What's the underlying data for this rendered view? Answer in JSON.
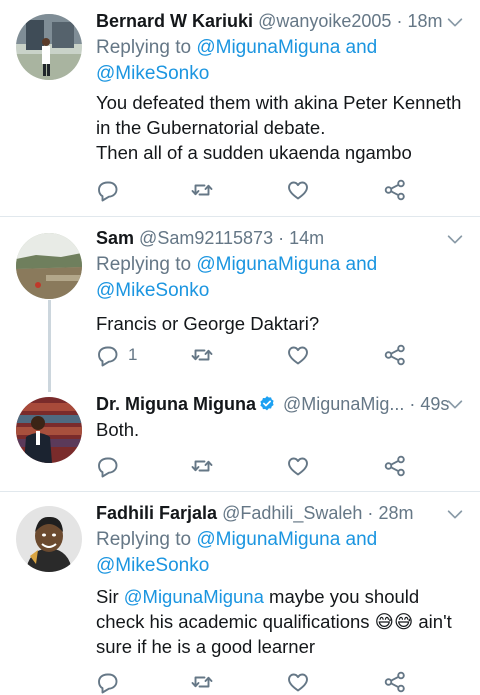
{
  "tweets": [
    {
      "name": "Bernard W Kariuki",
      "handle": "@wanyoike2005",
      "dot": "·",
      "time": "18m",
      "replying_prefix": "Replying to",
      "replying_to": [
        "@MigunaMiguna",
        "@MikeSonko"
      ],
      "replying_and": "and",
      "text_lines": [
        "You defeated them with akina Peter Kenneth",
        "in the Gubernatorial debate.",
        "Then all of a sudden ukaenda ngambo"
      ],
      "reply_count": ""
    },
    {
      "name": "Sam",
      "handle": "@Sam92115873",
      "dot": "·",
      "time": "14m",
      "replying_prefix": "Replying to",
      "replying_to": [
        "@MigunaMiguna",
        "@MikeSonko"
      ],
      "replying_and": "and",
      "text_lines": [
        "Francis or George Daktari?"
      ],
      "reply_count": "1"
    },
    {
      "name": "Dr. Miguna Miguna",
      "handle": "@MigunaMig...",
      "dot": "·",
      "time": "49s",
      "verified": true,
      "text_lines": [
        "Both."
      ],
      "reply_count": ""
    },
    {
      "name": "Fadhili Farjala",
      "handle": "@Fadhili_Swaleh",
      "dot": "·",
      "time": "28m",
      "replying_prefix": "Replying to",
      "replying_to": [
        "@MigunaMiguna",
        "@MikeSonko"
      ],
      "replying_and": "and",
      "text_parts": {
        "pre": "Sir ",
        "mention": "@MigunaMiguna",
        "mid": " maybe you should check his academic qualifications ",
        "emoji": "😅😅",
        "post": " ain't sure if he is a good learner"
      },
      "reply_count": ""
    }
  ],
  "icons": [
    "reply-icon",
    "retweet-icon",
    "like-icon",
    "share-icon",
    "chevron-down-icon",
    "verified-badge-icon"
  ],
  "colors": {
    "link": "#1b95e0",
    "secondary": "#657786",
    "divider": "#e1e8ed",
    "verified": "#1da1f2"
  }
}
